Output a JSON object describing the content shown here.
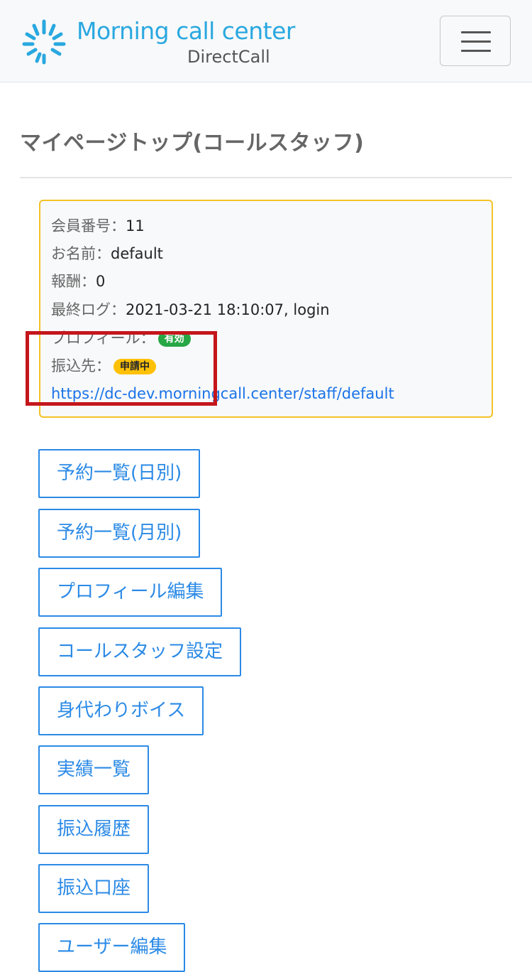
{
  "header": {
    "brand_name": "Morning call center",
    "brand_sub": "DirectCall",
    "brand_color": "#29a8e0",
    "logo_icon": "sunburst-logo-icon",
    "menu_icon": "hamburger-menu-icon"
  },
  "page": {
    "title": "マイページトップ(コールスタッフ)"
  },
  "profile": {
    "member_no_label": "会員番号：",
    "member_no": "11",
    "name_label": "お名前：",
    "name": "default",
    "reward_label": "報酬：",
    "reward": "0",
    "last_log_label": "最終ログ：",
    "last_log": "2021-03-21 18:10:07, login",
    "profile_label": "プロフィール：",
    "profile_status": "有効",
    "transfer_label": "振込先：",
    "transfer_status": "申請中",
    "url": "https://dc-dev.morningcall.center/staff/default"
  },
  "colors": {
    "card_border": "#f5c228",
    "badge_active": "#28a745",
    "badge_pending": "#ffc107",
    "highlight": "#c4161c",
    "link": "#1a73e8",
    "button": "#2b8ae6"
  },
  "menu": [
    {
      "label": "予約一覧(日別)"
    },
    {
      "label": "予約一覧(月別)"
    },
    {
      "label": "プロフィール編集"
    },
    {
      "label": "コールスタッフ設定"
    },
    {
      "label": "身代わりボイス"
    },
    {
      "label": "実績一覧"
    },
    {
      "label": "振込履歴"
    },
    {
      "label": "振込口座"
    },
    {
      "label": "ユーザー編集"
    }
  ]
}
